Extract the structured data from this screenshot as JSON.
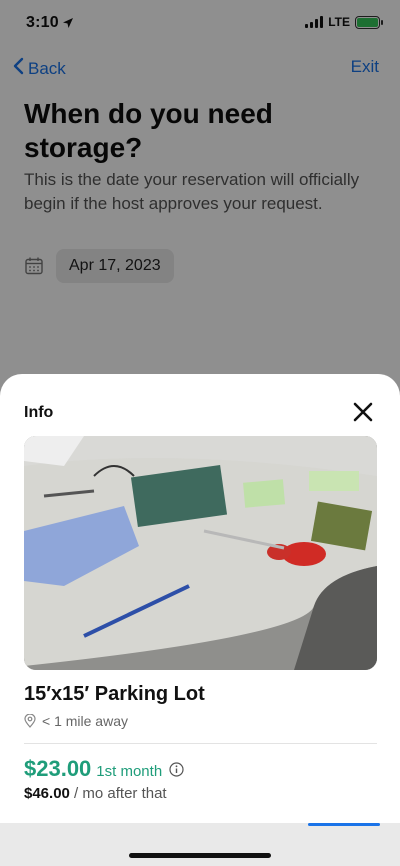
{
  "status": {
    "time": "3:10",
    "network": "LTE"
  },
  "nav": {
    "back_label": "Back",
    "exit_label": "Exit"
  },
  "page": {
    "title": "When do you need storage?",
    "subtitle": "This is the date your reservation will officially begin if the host approves your request.",
    "date": "Apr 17, 2023"
  },
  "sheet": {
    "title": "Info",
    "listing_title": "15′x15′ Parking Lot",
    "distance": "< 1 mile away",
    "price_main": "$23.00",
    "price_period": "1st month",
    "price_after_amount": "$46.00",
    "price_after_suffix": " / mo after that"
  },
  "colors": {
    "accent": "#1a73e8",
    "price": "#1f9d7a",
    "battery": "#34c759"
  },
  "icons": {
    "back": "chevron-left-icon",
    "calendar": "calendar-icon",
    "close": "close-icon",
    "location": "location-pin-icon",
    "info": "info-icon"
  }
}
